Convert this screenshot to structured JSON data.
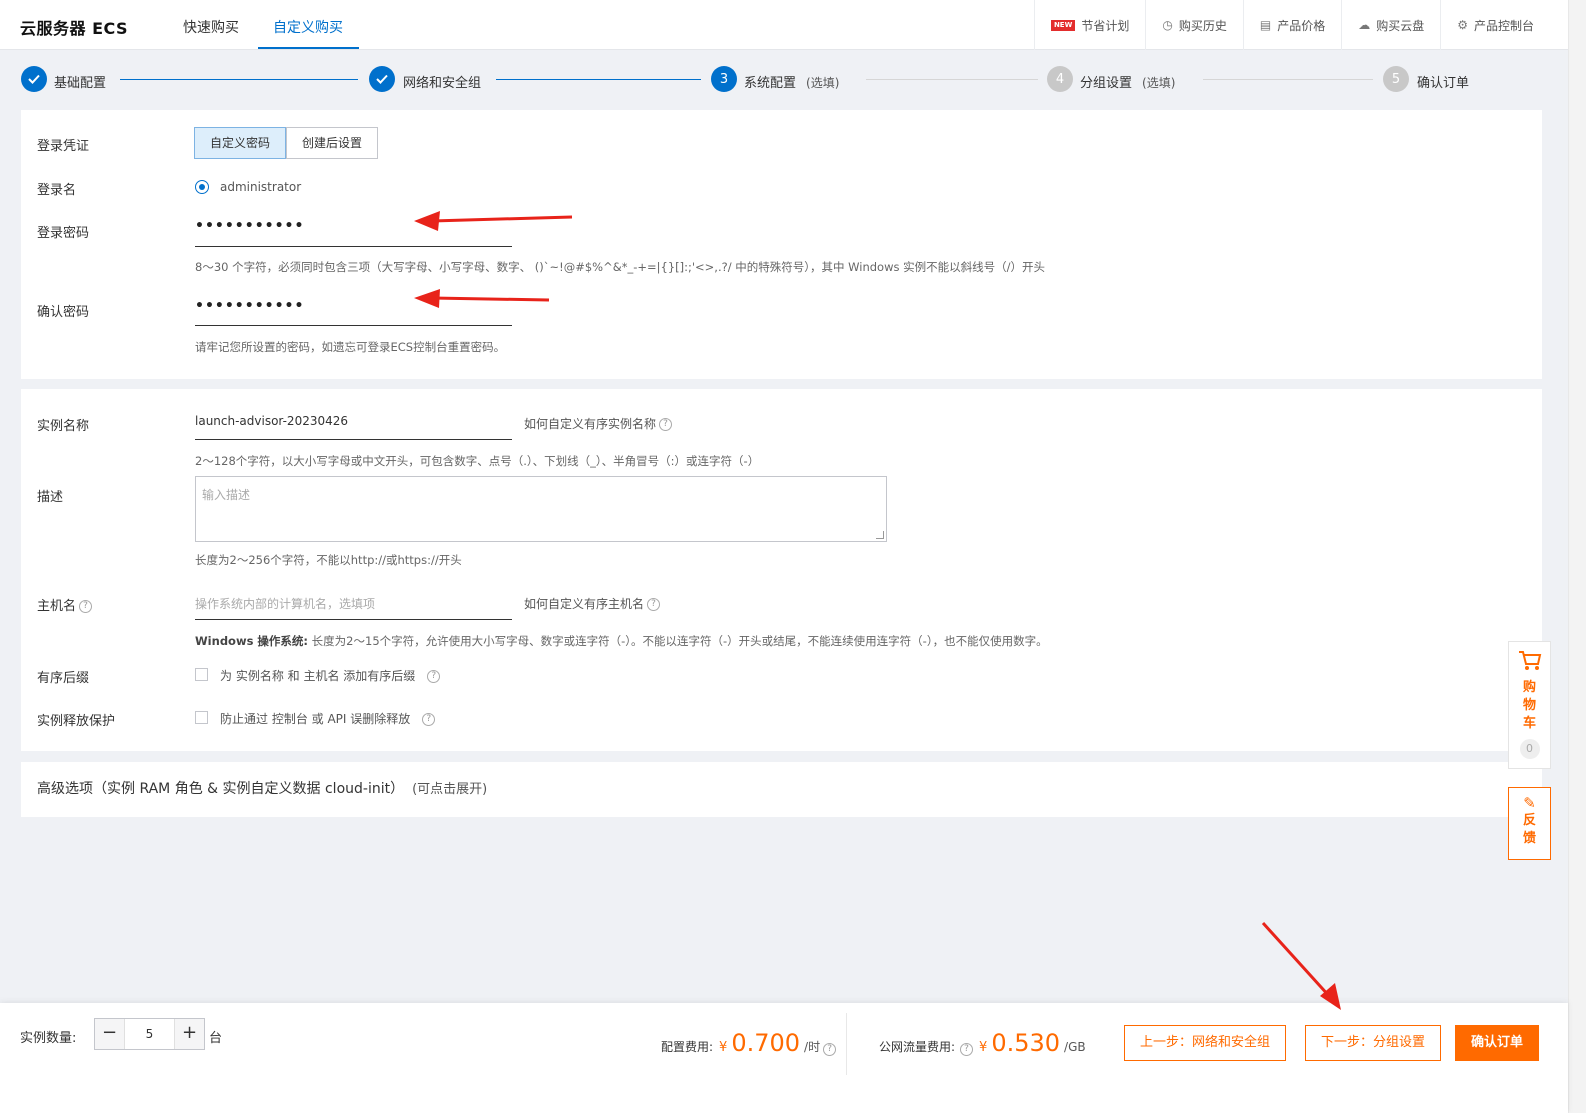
{
  "header": {
    "brand": "云服务器 ECS",
    "tabs": [
      {
        "label": "快速购买"
      },
      {
        "label": "自定义购买"
      }
    ],
    "links": [
      {
        "label": "节省计划",
        "badge": "NEW"
      },
      {
        "label": "购买历史",
        "icon": "clock-icon"
      },
      {
        "label": "产品价格",
        "icon": "list-icon"
      },
      {
        "label": "购买云盘",
        "icon": "cloud-icon"
      },
      {
        "label": "产品控制台",
        "icon": "gear-icon"
      }
    ]
  },
  "steps": [
    {
      "label": "基础配置",
      "state": "done"
    },
    {
      "label": "网络和安全组",
      "state": "done"
    },
    {
      "num": "3",
      "label": "系统配置",
      "optional": "(选填)",
      "state": "active"
    },
    {
      "num": "4",
      "label": "分组设置",
      "optional": "(选填)",
      "state": "todo"
    },
    {
      "num": "5",
      "label": "确认订单",
      "state": "todo"
    }
  ],
  "login": {
    "credential_label": "登录凭证",
    "credential_options": [
      "自定义密码",
      "创建后设置"
    ],
    "username_label": "登录名",
    "username_value": "administrator",
    "password_label": "登录密码",
    "password_value": "•••••••••••",
    "password_hint": "8～30 个字符，必须同时包含三项（大写字母、小写字母、数字、 ()`~!@#$%^&*_-+=|{}[]:;'<>,.?/ 中的特殊符号），其中 Windows 实例不能以斜线号（/）开头",
    "confirm_label": "确认密码",
    "confirm_value": "•••••••••••",
    "confirm_hint": "请牢记您所设置的密码，如遗忘可登录ECS控制台重置密码。"
  },
  "instance": {
    "name_label": "实例名称",
    "name_value": "launch-advisor-20230426",
    "name_help": "如何自定义有序实例名称",
    "name_hint": "2～128个字符，以大小写字母或中文开头，可包含数字、点号（.）、下划线（_）、半角冒号（:）或连字符（-）",
    "desc_label": "描述",
    "desc_placeholder": "输入描述",
    "desc_hint": "长度为2～256个字符，不能以http://或https://开头",
    "host_label": "主机名",
    "host_placeholder": "操作系统内部的计算机名，选填项",
    "host_help": "如何自定义有序主机名",
    "host_hint_bold": "Windows 操作系统:",
    "host_hint": " 长度为2～15个字符，允许使用大小写字母、数字或连字符（-）。不能以连字符（-）开头或结尾，不能连续使用连字符（-），也不能仅使用数字。",
    "suffix_label": "有序后缀",
    "suffix_text": "为 实例名称 和 主机名 添加有序后缀",
    "protect_label": "实例释放保护",
    "protect_text": "防止通过 控制台 或 API 误删除释放"
  },
  "advanced": {
    "title": "高级选项（实例 RAM 角色 & 实例自定义数据 cloud-init）",
    "sub": "(可点击展开)"
  },
  "side": {
    "cart_text": [
      "购",
      "物",
      "车"
    ],
    "cart_count": "0",
    "feedback_text": [
      "反",
      "馈"
    ]
  },
  "footer": {
    "qty_label": "实例数量:",
    "qty_value": "5",
    "qty_unit": "台",
    "config_fee_label": "配置费用:",
    "currency": "¥",
    "config_fee": "0.700",
    "config_fee_unit": "/时",
    "traffic_fee_label": "公网流量费用:",
    "traffic_fee": "0.530",
    "traffic_fee_unit": "/GB",
    "prev_button": "上一步：网络和安全组",
    "next_button": "下一步：分组设置",
    "confirm_button": "确认订单"
  },
  "colors": {
    "primary": "#0070cc",
    "accent": "#ff6a00",
    "annotation_arrow": "#e8231a"
  }
}
